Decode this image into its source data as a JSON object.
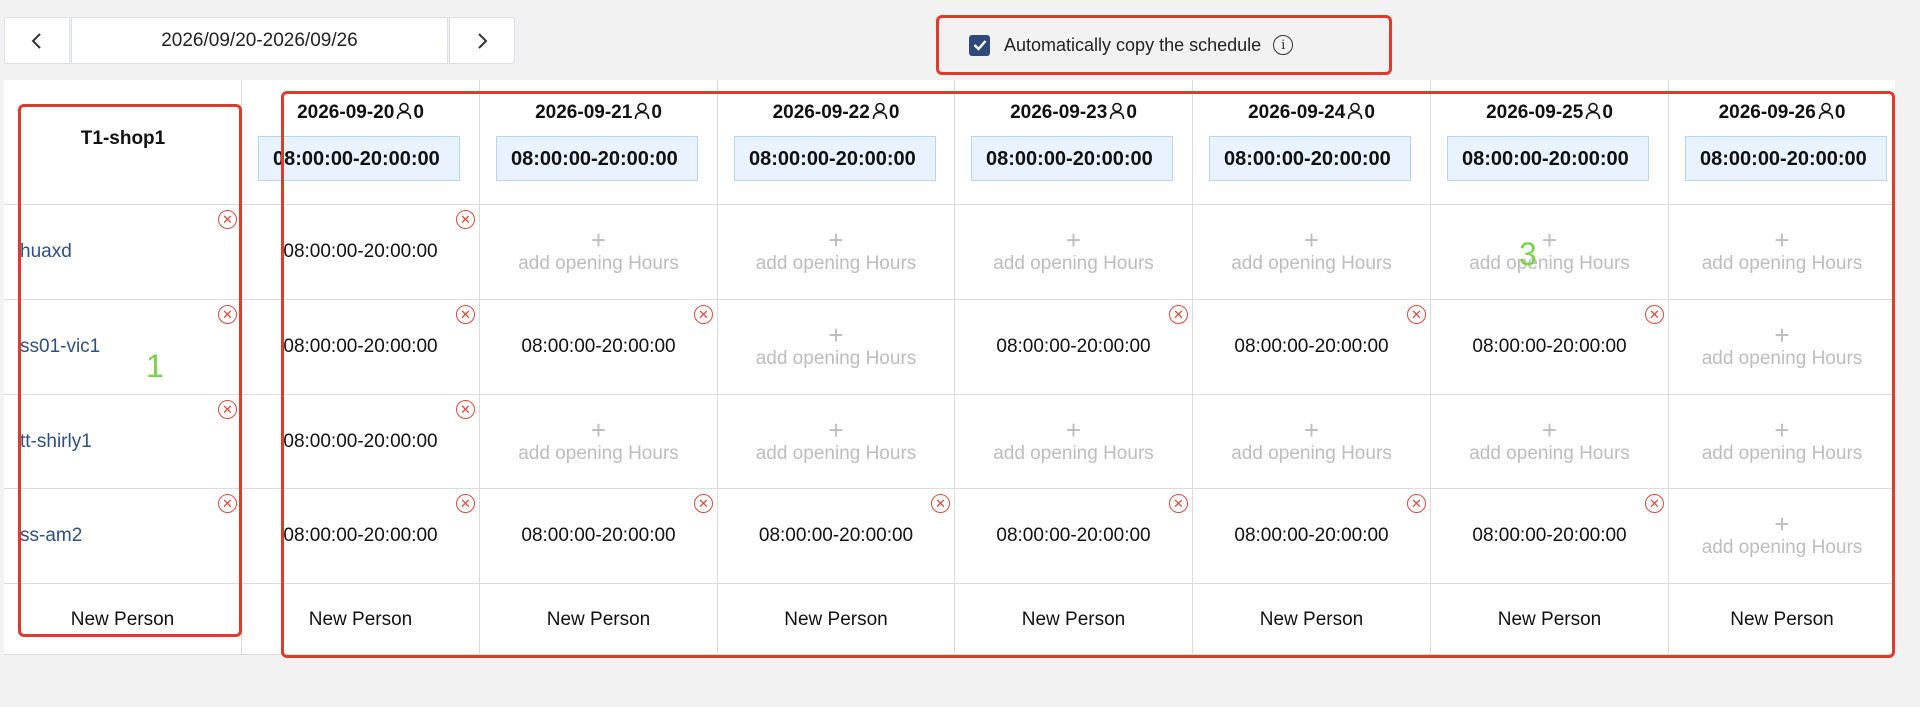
{
  "toolbar": {
    "date_range": "2026/09/20-2026/09/26",
    "auto_copy": {
      "checked": true,
      "label": "Automatically copy the schedule"
    }
  },
  "schedule": {
    "shop": "T1-shop1",
    "days": [
      {
        "date": "2026-09-20",
        "count": "0",
        "hours": "08:00:00-20:00:00"
      },
      {
        "date": "2026-09-21",
        "count": "0",
        "hours": "08:00:00-20:00:00"
      },
      {
        "date": "2026-09-22",
        "count": "0",
        "hours": "08:00:00-20:00:00"
      },
      {
        "date": "2026-09-23",
        "count": "0",
        "hours": "08:00:00-20:00:00"
      },
      {
        "date": "2026-09-24",
        "count": "0",
        "hours": "08:00:00-20:00:00"
      },
      {
        "date": "2026-09-25",
        "count": "0",
        "hours": "08:00:00-20:00:00"
      },
      {
        "date": "2026-09-26",
        "count": "0",
        "hours": "08:00:00-20:00:00"
      }
    ],
    "people": [
      {
        "name": "huaxd",
        "shifts": [
          "08:00:00-20:00:00",
          null,
          null,
          null,
          null,
          null,
          null
        ]
      },
      {
        "name": "ss01-vic1",
        "shifts": [
          "08:00:00-20:00:00",
          "08:00:00-20:00:00",
          null,
          "08:00:00-20:00:00",
          "08:00:00-20:00:00",
          "08:00:00-20:00:00",
          null
        ]
      },
      {
        "name": "tt-shirly1",
        "shifts": [
          "08:00:00-20:00:00",
          null,
          null,
          null,
          null,
          null,
          null
        ]
      },
      {
        "name": "ss-am2",
        "shifts": [
          "08:00:00-20:00:00",
          "08:00:00-20:00:00",
          "08:00:00-20:00:00",
          "08:00:00-20:00:00",
          "08:00:00-20:00:00",
          "08:00:00-20:00:00",
          null
        ]
      }
    ],
    "add_hours_label": "add opening Hours",
    "new_person_label": "New Person"
  },
  "annotations": [
    {
      "label": "1"
    },
    {
      "label": "3"
    }
  ],
  "colors": {
    "annotation_box": "#e03a2c",
    "annotation_number": "#7bd34a",
    "checkbox": "#2f4a7a",
    "person_name": "#2c4f86",
    "remove": "#e0473c"
  }
}
